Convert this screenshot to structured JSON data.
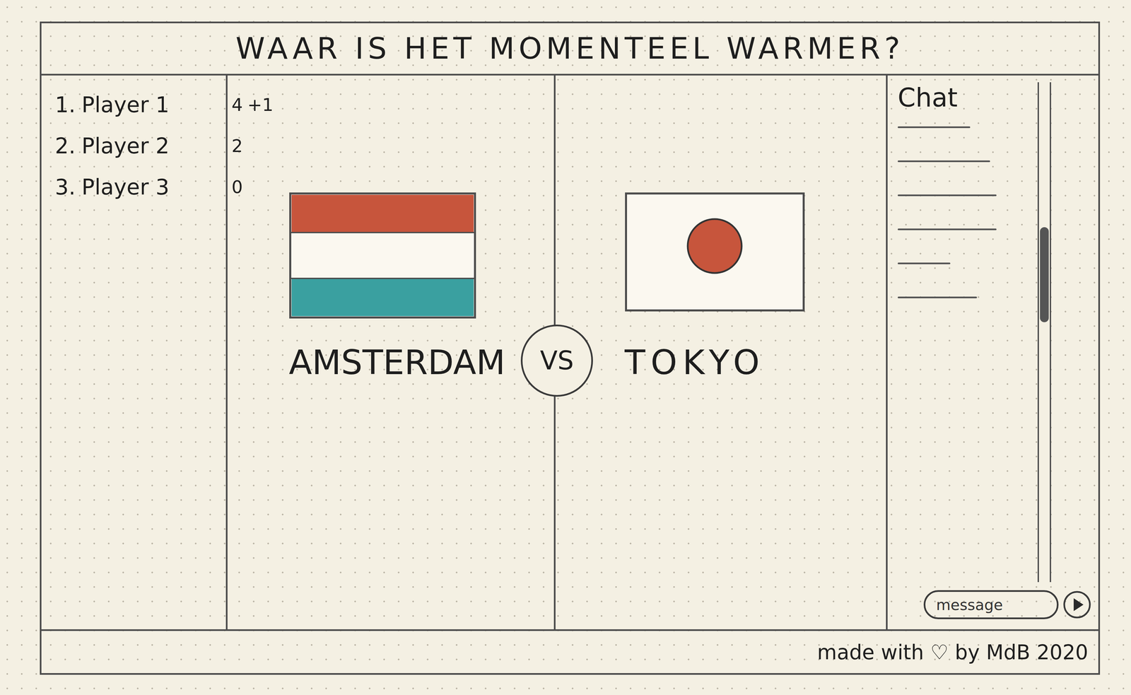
{
  "title": "WAAR IS HET MOMENTEEL WARMER?",
  "leaderboard": [
    {
      "rank": "1.",
      "name": "Player 1",
      "score": "4",
      "delta": "+1"
    },
    {
      "rank": "2.",
      "name": "Player 2",
      "score": "2"
    },
    {
      "rank": "3.",
      "name": "Player 3",
      "score": "0"
    }
  ],
  "match": {
    "cities": [
      {
        "name": "AMSTERDAM",
        "kind": "netherlands"
      },
      {
        "name": "TOKYO",
        "kind": "japan"
      }
    ],
    "versus": "VS"
  },
  "chat": {
    "title": "Chat",
    "messages": [
      {
        "level": 0.55
      },
      {
        "level": 0.7
      },
      {
        "level": 0.75
      },
      {
        "level": 0.75
      },
      {
        "level": 0.4
      },
      {
        "level": 0.6
      }
    ],
    "scrollbar": {
      "level": 0.29
    },
    "input": {
      "placeholder": "message"
    }
  },
  "footer": {
    "credit": "made with ♡ by MdB 2020"
  }
}
